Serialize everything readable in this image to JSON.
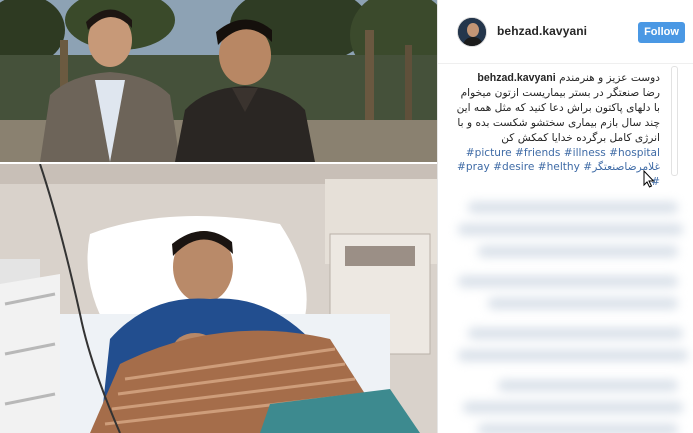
{
  "post": {
    "username": "behzad.kavyani",
    "follow_label": "Follow",
    "caption_user": "behzad.kavyani",
    "caption_text_1": "دوست عزیز و هنرمندم رضا صنعتگر در بستر بیماریست ازتون میخوام با دلهای پاکتون براش دعا کنید که مثل همه این چند سال بازم بیماری سختشو شکست بده و با انرژی کامل برگرده خدایا کمکش کن",
    "hashtags": [
      "#picture",
      "#friends",
      "#illness",
      "#hospital",
      "#pray",
      "#desire",
      "#helthy",
      "#غلامرضاصنعتگر",
      "#"
    ],
    "blurred_dots": "•••••••"
  },
  "icons": {
    "avatar": "profile-photo",
    "cursor": "mouse-pointer-icon"
  },
  "colors": {
    "follow_button": "#4a98e4",
    "hashtag": "#3f6ba6",
    "text": "#262626"
  }
}
